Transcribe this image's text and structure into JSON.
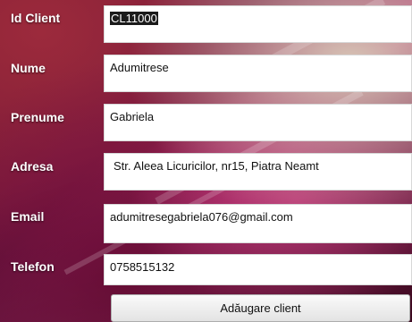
{
  "form": {
    "id_client": {
      "label": "Id Client",
      "value": "CL11000"
    },
    "nume": {
      "label": "Nume",
      "value": "Adumitrese"
    },
    "prenume": {
      "label": "Prenume",
      "value": "Gabriela"
    },
    "adresa": {
      "label": "Adresa",
      "value": "Str. Aleea Licuricilor, nr15, Piatra Neamt"
    },
    "email": {
      "label": "Email",
      "value": "adumitresegabriela076@gmail.com"
    },
    "telefon": {
      "label": "Telefon",
      "value": "0758515132"
    }
  },
  "actions": {
    "add_client": "Adăugare client"
  }
}
